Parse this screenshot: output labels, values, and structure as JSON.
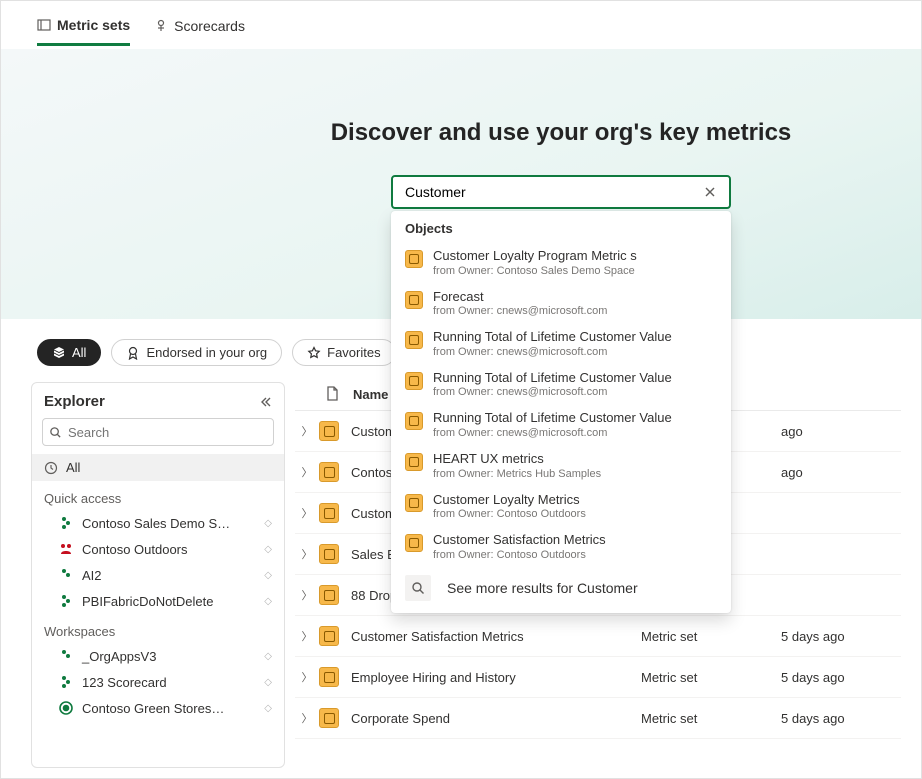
{
  "tabs": {
    "metric_sets": "Metric sets",
    "scorecards": "Scorecards"
  },
  "hero": {
    "title": "Discover and use your org's key metrics",
    "search_value": "Customer"
  },
  "suggest": {
    "header": "Objects",
    "items": [
      {
        "name": "Customer Loyalty Program Metric s",
        "owner": "from Owner: Contoso Sales Demo Space"
      },
      {
        "name": "Forecast",
        "owner": "from Owner: cnews@microsoft.com"
      },
      {
        "name": "Running Total of Lifetime Customer Value",
        "owner": "from Owner: cnews@microsoft.com"
      },
      {
        "name": "Running Total of Lifetime Customer Value",
        "owner": "from Owner: cnews@microsoft.com"
      },
      {
        "name": "Running Total of Lifetime Customer Value",
        "owner": "from Owner: cnews@microsoft.com"
      },
      {
        "name": "HEART UX metrics",
        "owner": "from Owner: Metrics Hub Samples"
      },
      {
        "name": "Customer Loyalty Metrics",
        "owner": "from Owner: Contoso Outdoors"
      },
      {
        "name": "Customer Satisfaction Metrics",
        "owner": "from Owner: Contoso Outdoors"
      }
    ],
    "more": "See more results for Customer"
  },
  "filters": {
    "all": "All",
    "endorsed": "Endorsed in your org",
    "favorites": "Favorites"
  },
  "explorer": {
    "title": "Explorer",
    "search_placeholder": "Search",
    "all": "All",
    "quick_access": "Quick access",
    "quick_items": [
      "Contoso Sales Demo S…",
      "Contoso Outdoors",
      "AI2",
      "PBIFabricDoNotDelete"
    ],
    "workspaces": "Workspaces",
    "workspace_items": [
      "_OrgAppsV3",
      "123 Scorecard",
      "Contoso Green   Stores…"
    ]
  },
  "table": {
    "col_name": "Name",
    "rows": [
      {
        "name": "Customer Loyalty Program Met",
        "type": "",
        "time": "ago"
      },
      {
        "name": "Contoso Sales Metrics Set",
        "type": "",
        "time": "ago"
      },
      {
        "name": "Customer Loyalty Metrics",
        "type": "",
        "time": ""
      },
      {
        "name": "Sales Excellence Metric Set",
        "type": "",
        "time": ""
      },
      {
        "name": "88 Drops Return",
        "type": "",
        "time": ""
      },
      {
        "name": "Customer Satisfaction Metrics",
        "type": "Metric set",
        "time": "5 days ago"
      },
      {
        "name": "Employee Hiring and History",
        "type": "Metric set",
        "time": "5 days ago"
      },
      {
        "name": "Corporate Spend",
        "type": "Metric set",
        "time": "5 days ago"
      }
    ]
  }
}
